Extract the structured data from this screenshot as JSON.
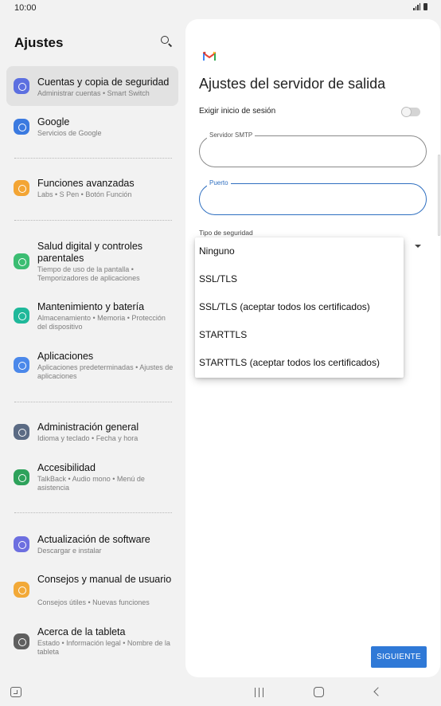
{
  "status_bar": {
    "time": "10:00"
  },
  "settings": {
    "title": "Ajustes",
    "items": [
      {
        "title": "Cuentas y copia de seguridad",
        "subtitle": "Administrar cuentas  •  Smart Switch",
        "icon": "sync-icon",
        "color": "#5c6fe0",
        "selected": true
      },
      {
        "title": "Google",
        "subtitle": "Servicios de Google",
        "icon": "google-icon",
        "color": "#3b7ae0"
      },
      {
        "title": "Funciones avanzadas",
        "subtitle": "Labs  •  S Pen  •  Botón Función",
        "icon": "star-gear-icon",
        "color": "#f3a534"
      },
      {
        "title": "Salud digital y controles parentales",
        "subtitle": "Tiempo de uso de la pantalla  •  Temporizadores de aplicaciones",
        "icon": "digital-wellbeing-icon",
        "color": "#3bbd72"
      },
      {
        "title": "Mantenimiento y batería",
        "subtitle": "Almacenamiento  •  Memoria  •  Protección del dispositivo",
        "icon": "device-care-icon",
        "color": "#1fb89a"
      },
      {
        "title": "Aplicaciones",
        "subtitle": "Aplicaciones predeterminadas  •  Ajustes de aplicaciones",
        "icon": "apps-icon",
        "color": "#4b88ea"
      },
      {
        "title": "Administración general",
        "subtitle": "Idioma y teclado  •  Fecha y hora",
        "icon": "sliders-icon",
        "color": "#5b6b84"
      },
      {
        "title": "Accesibilidad",
        "subtitle": "TalkBack  •  Audio mono  •  Menú de asistencia",
        "icon": "accessibility-icon",
        "color": "#2ea25b"
      },
      {
        "title": "Actualización de software",
        "subtitle": "Descargar e instalar",
        "icon": "software-update-icon",
        "color": "#6d6fe0"
      },
      {
        "title": "Consejos y manual de usuario",
        "subtitle": "Consejos útiles  •  Nuevas funciones",
        "icon": "lightbulb-icon",
        "color": "#f2a938"
      },
      {
        "title": "Acerca de la tableta",
        "subtitle": "Estado  •  Información legal  •  Nombre de la tableta",
        "icon": "info-icon",
        "color": "#5f5f5f"
      }
    ]
  },
  "detail": {
    "title": "Ajustes del servidor de salida",
    "login_label": "Exigir inicio de sesión",
    "login_enabled": false,
    "smtp_label": "Servidor SMTP",
    "smtp_value": "",
    "port_label": "Puerto",
    "port_value": "",
    "security_label": "Tipo de seguridad",
    "security_options": [
      "Ninguno",
      "SSL/TLS",
      "SSL/TLS (aceptar todos los certificados)",
      "STARTTLS",
      "STARTTLS (aceptar todos los certificados)"
    ],
    "next_button": "SIGUIENTE"
  },
  "colors": {
    "accent": "#2f79d7",
    "focus": "#2f6fc0",
    "gmail_red": "#ea4335",
    "gmail_blue": "#4285f4",
    "gmail_green": "#34a853",
    "gmail_yellow": "#fbbc05"
  }
}
